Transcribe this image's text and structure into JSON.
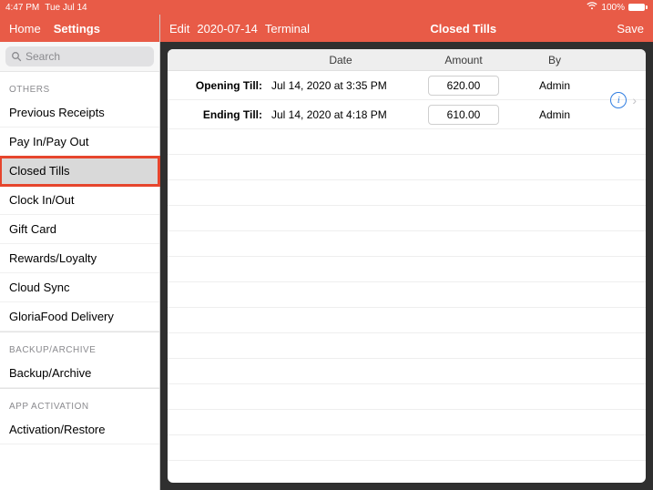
{
  "statusbar": {
    "time": "4:47 PM",
    "date": "Tue Jul 14",
    "battery": "100%"
  },
  "sidebar": {
    "nav": {
      "home": "Home",
      "settings": "Settings"
    },
    "search_placeholder": "Search",
    "sections": [
      {
        "label": "OTHERS",
        "items": [
          {
            "id": "previous-receipts",
            "label": "Previous Receipts"
          },
          {
            "id": "pay-in-out",
            "label": "Pay In/Pay Out"
          },
          {
            "id": "closed-tills",
            "label": "Closed Tills",
            "selected": true,
            "highlighted": true
          },
          {
            "id": "clock-in-out",
            "label": "Clock In/Out"
          },
          {
            "id": "gift-card",
            "label": "Gift Card"
          },
          {
            "id": "rewards-loyalty",
            "label": "Rewards/Loyalty"
          },
          {
            "id": "cloud-sync",
            "label": "Cloud Sync"
          },
          {
            "id": "gloriafood",
            "label": "GloriaFood Delivery"
          }
        ]
      },
      {
        "label": "BACKUP/ARCHIVE",
        "items": [
          {
            "id": "backup-archive",
            "label": "Backup/Archive"
          }
        ]
      },
      {
        "label": "APP ACTIVATION",
        "items": [
          {
            "id": "activation-restore",
            "label": "Activation/Restore"
          }
        ]
      }
    ]
  },
  "main": {
    "edit": "Edit",
    "context_date": "2020-07-14",
    "context_scope": "Terminal",
    "title": "Closed Tills",
    "save": "Save",
    "columns": {
      "date": "Date",
      "amount": "Amount",
      "by": "By"
    },
    "rows": [
      {
        "label": "Opening Till:",
        "date": "Jul 14, 2020 at 3:35 PM",
        "amount": "620.00",
        "by": "Admin"
      },
      {
        "label": "Ending Till:",
        "date": "Jul 14, 2020 at 4:18 PM",
        "amount": "610.00",
        "by": "Admin"
      }
    ]
  }
}
